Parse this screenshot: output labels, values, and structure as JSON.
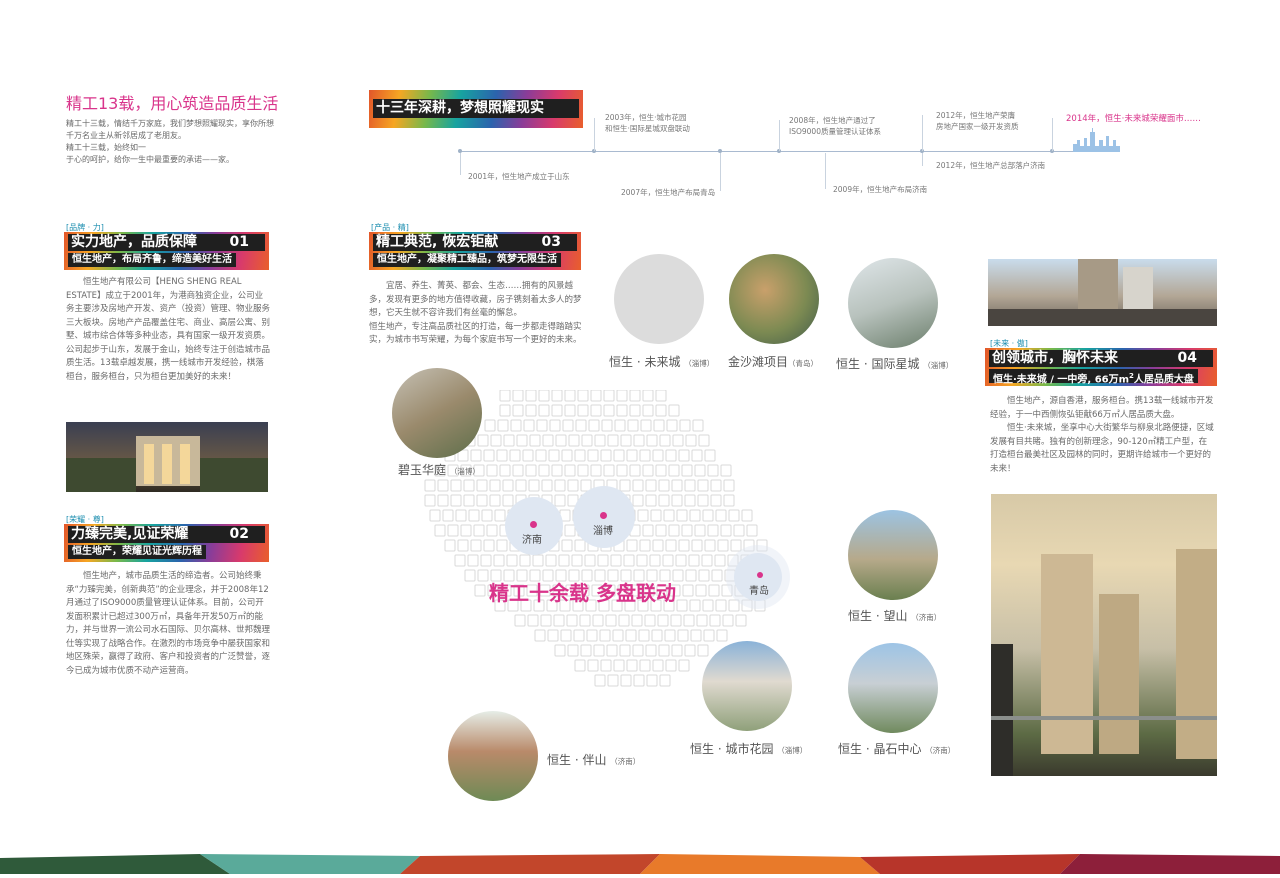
{
  "intro": {
    "title": "精工13载，用心筑造品质生活",
    "lines": [
      "精工十三载，情结千万家庭，我们梦想照耀现实，享你所想",
      "千万名业主从新邻居成了老朋友。",
      "精工十三载，始终如一",
      "于心的呵护，给你一生中最重要的承诺——家。"
    ]
  },
  "timeline": {
    "banner": "十三年深耕，梦想照耀现实",
    "events": [
      {
        "text": "2001年，恒生地产成立于山东"
      },
      {
        "text": "2003年，恒生·城市花园\n和恒生·国际星城双盘联动"
      },
      {
        "text": "2007年，恒生地产布局青岛"
      },
      {
        "text": "2008年，恒生地产通过了\nISO9000质量管理认证体系"
      },
      {
        "text": "2009年，恒生地产布局济南"
      },
      {
        "text": "2012年，恒生地产荣膺\n房地产国家一级开发资质"
      },
      {
        "text": "2012年，恒生地产总部落户济南"
      },
      {
        "text": "2014年，恒生·未来城荣耀面市……"
      }
    ]
  },
  "sec1": {
    "tag": "[品牌 · 力]",
    "heading": "实力地产，品质保障",
    "num": "01",
    "sub": "恒生地产，布局齐鲁，缔造美好生活",
    "body": [
      "恒生地产有限公司【HENG SHENG REAL ESTATE】成立于2001年，为港商独资企业，公司业务主要涉及房地产开发、资产（投资）管理、物业服务三大板块。房地产产品覆盖住宅、商业、高层公寓、别墅、城市综合体等多种业态，具有国家一级开发资质。",
      "公司起步于山东，发展于金山，始终专注于创造城市品质生活。13载卓越发展，携一线城市开发经验，棋落桓台，服务桓台，只为桓台更加美好的未来！"
    ]
  },
  "sec2": {
    "tag": "[荣耀 · 尊]",
    "heading": "力臻完美,见证荣耀",
    "num": "02",
    "sub": "恒生地产，荣耀见证光辉历程",
    "body": [
      "恒生地产，城市品质生活的缔造者。公司始终秉承“力臻完美，创新典范”的企业理念，并于2008年12月通过了ISO9000质量管理认证体系。目前，公司开发面积累计已超过300万㎡，具备年开发50万㎡的能力，并与世界一流公司水石国际、贝尔高林、世邦魏理仕等实现了战略合作。在激烈的市场竞争中屡获国家和地区殊荣，赢得了政府、客户和投资者的广泛赞誉，逐今已成为城市优质不动产运营商。"
    ]
  },
  "sec3": {
    "tag": "[产品 · 精]",
    "heading": "精工典范, 恢宏钜献",
    "num": "03",
    "sub": "恒生地产，凝聚精工臻品，筑梦无限生活",
    "body": [
      "宜居、养生、菁英、都会、生态……拥有的风景越多，发现有更多的地方值得收藏，房子镌刻着太多人的梦想，它天生就不容许我们有丝毫的懈怠。",
      "恒生地产，专注高品质社区的打造，每一步都走得踏踏实实，为城市书写荣耀，为每个家庭书写一个更好的未来。"
    ]
  },
  "sec4": {
    "tag": "[未来 · 傲]",
    "heading": "创领城市，胸怀未来",
    "num": "04",
    "sub_a": "恒生·未来城 / 一中旁, 66万m",
    "sub_sup": "2",
    "sub_b": "人居品质大盘",
    "body": [
      "恒生地产，源自香港，服务桓台。携13载一线城市开发经验，于一中西侧恢弘钜献66万㎡人居品质大盘。",
      "恒生·未来城，坐享中心大街繁华与柳泉北路便捷，区域发展有目共睹。独有的创新理念，90-120㎡精工户型，在打造桓台最美社区及园林的同时，更期许给城市一个更好的未来！"
    ]
  },
  "map": {
    "slogan": "精工十余载 多盘联动",
    "cities": [
      "济南",
      "淄博",
      "青岛"
    ]
  },
  "projects": [
    {
      "name": "恒生 · 未来城",
      "city": "（淄博）"
    },
    {
      "name": "金沙滩项目",
      "city": "（青岛）"
    },
    {
      "name": "恒生 · 国际星城",
      "city": "（淄博）"
    },
    {
      "name": "碧玉华庭",
      "city": "（淄博）"
    },
    {
      "name": "恒生 · 望山",
      "city": "（济南）"
    },
    {
      "name": "恒生 · 伴山",
      "city": "（济南）"
    },
    {
      "name": "恒生 · 城市花园",
      "city": "（淄博）"
    },
    {
      "name": "恒生 · 晶石中心",
      "city": "（济南）"
    }
  ],
  "colors": {
    "accent_pink": "#d9348b",
    "map_cell": "#d8d8d8",
    "city_circle": "#dfe7f2"
  }
}
